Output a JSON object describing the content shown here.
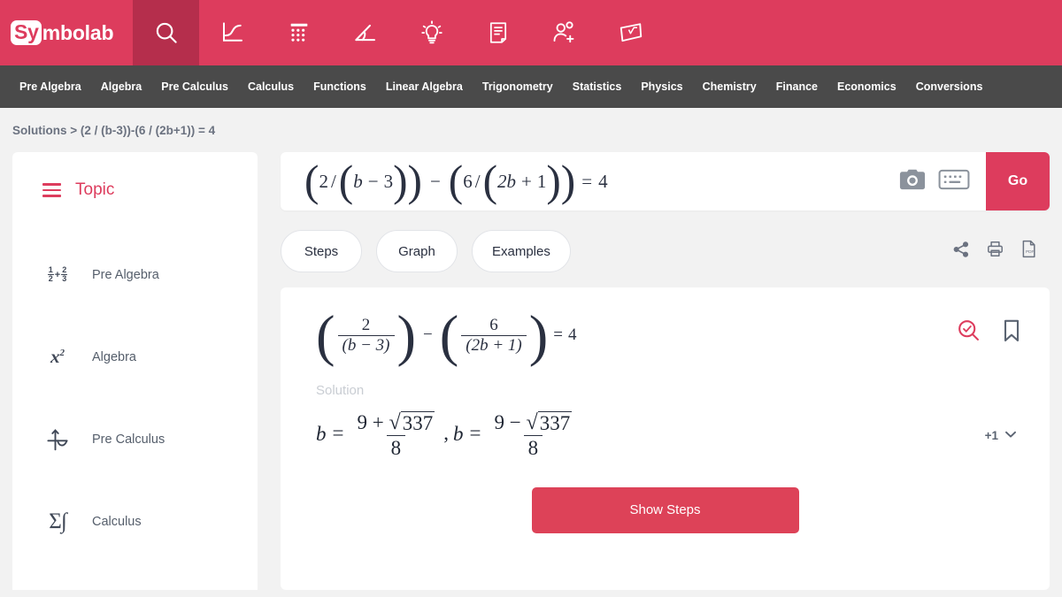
{
  "brand": {
    "name_prefix": "Sy",
    "name_suffix": "mbolab",
    "accent": "#dd3c5d",
    "accent_dark": "#b52e4c",
    "subnav_bg": "#4a4a4a"
  },
  "header": {
    "icons": [
      {
        "name": "search-icon",
        "label": "Search",
        "active": true
      },
      {
        "name": "graphing-calculator-icon",
        "label": "Graphing Calculator",
        "active": false
      },
      {
        "name": "calculator-icon",
        "label": "Calculator",
        "active": false
      },
      {
        "name": "geometry-icon",
        "label": "Geometry",
        "active": false
      },
      {
        "name": "practice-lightbulb-icon",
        "label": "Practice",
        "active": false
      },
      {
        "name": "notebook-icon",
        "label": "Notebook",
        "active": false
      },
      {
        "name": "groups-join-icon",
        "label": "Groups",
        "active": false
      },
      {
        "name": "cheat-sheets-icon",
        "label": "Cheat Sheets",
        "active": false
      }
    ]
  },
  "subnav": {
    "items": [
      "Pre Algebra",
      "Algebra",
      "Pre Calculus",
      "Calculus",
      "Functions",
      "Linear Algebra",
      "Trigonometry",
      "Statistics",
      "Physics",
      "Chemistry",
      "Finance",
      "Economics",
      "Conversions"
    ]
  },
  "breadcrumb": {
    "text": "Solutions > (2 / (b-3))-(6 / (2b+1)) = 4"
  },
  "sidebar": {
    "title": "Topic",
    "menu_icon": "hamburger-icon",
    "items": [
      {
        "label": "Pre Algebra",
        "icon": "fraction-sum-icon"
      },
      {
        "label": "Algebra",
        "icon": "x-squared-icon"
      },
      {
        "label": "Pre Calculus",
        "icon": "function-curve-icon"
      },
      {
        "label": "Calculus",
        "icon": "sigma-integral-icon"
      }
    ]
  },
  "input_bar": {
    "expression_plain": "(2/(b-3))-(6/(2b+1))=4",
    "expression_parts": {
      "open1": "(",
      "num1": "2",
      "slash1": "/",
      "open2": "(",
      "var1": "b",
      "minus1": "−",
      "three": "3",
      "close2": ")",
      "close1": ")",
      "op": "−",
      "open3": "(",
      "num2": "6",
      "slash2": "/",
      "open4": "(",
      "two_b": "2b",
      "plus": "+",
      "one": "1",
      "close4": ")",
      "close3": ")",
      "equals": "=",
      "rhs": "4"
    },
    "camera_icon": "camera-icon",
    "keyboard_icon": "keyboard-icon",
    "go_label": "Go"
  },
  "tabs": [
    {
      "label": "Steps",
      "name": "tab-steps"
    },
    {
      "label": "Graph",
      "name": "tab-graph"
    },
    {
      "label": "Examples",
      "name": "tab-examples"
    }
  ],
  "tab_actions": [
    {
      "name": "share-icon",
      "label": "Share"
    },
    {
      "name": "print-icon",
      "label": "Print"
    },
    {
      "name": "pdf-icon",
      "label": "PDF"
    }
  ],
  "result_card": {
    "equation": {
      "frac1_num": "2",
      "frac1_den": "(b − 3)",
      "operator": "−",
      "frac2_num": "6",
      "frac2_den": "(2b + 1)",
      "equals": "=",
      "rhs": "4"
    },
    "solution_label": "Solution",
    "answer": {
      "var1": "b",
      "eq1": "=",
      "a1_num_lead": "9 +",
      "a1_radicand": "337",
      "a1_den": "8",
      "comma": ",",
      "var2": "b",
      "eq2": "=",
      "a2_num_lead": "9 −",
      "a2_radicand": "337",
      "a2_den": "8"
    },
    "verify_icon": "verify-magnifier-icon",
    "bookmark_icon": "bookmark-icon",
    "more_count": "+1",
    "chevron_icon": "chevron-down-icon",
    "show_steps_label": "Show Steps"
  }
}
